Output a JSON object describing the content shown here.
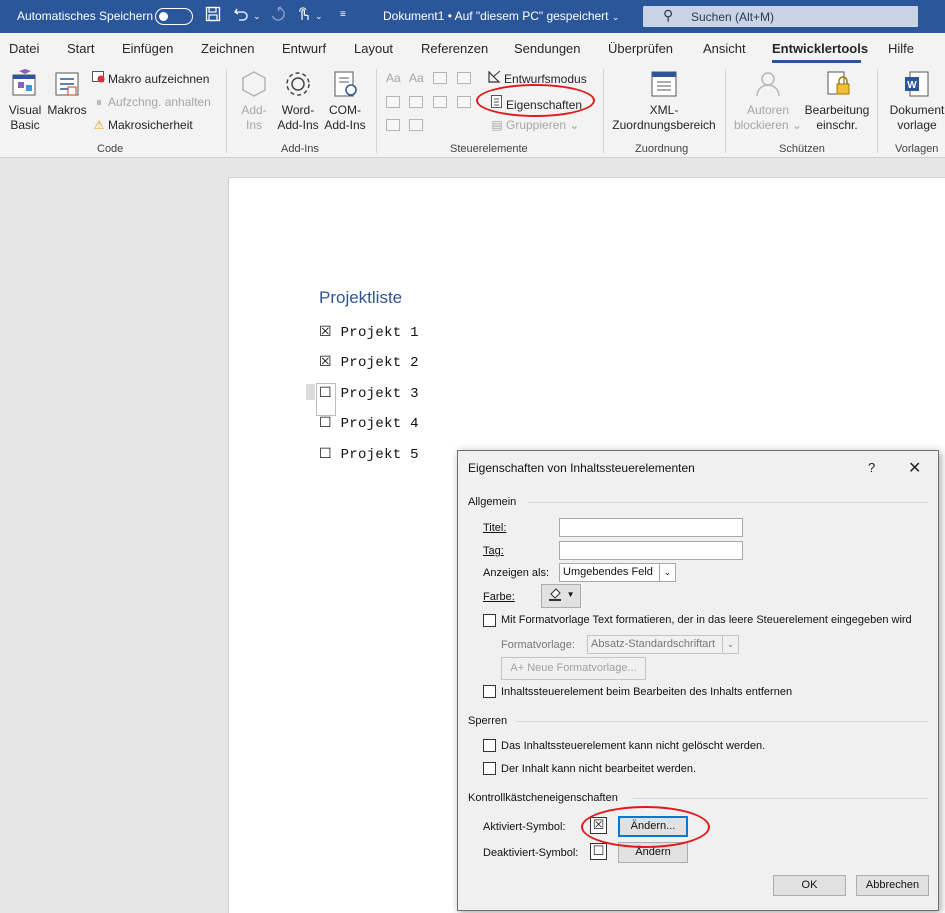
{
  "titlebar": {
    "autosave_label": "Automatisches Speichern",
    "doc_title": "Dokument1 • Auf \"diesem PC\" gespeichert",
    "doc_chevron": "⌄",
    "search_placeholder": "Suchen (Alt+M)"
  },
  "tabs": [
    "Datei",
    "Start",
    "Einfügen",
    "Zeichnen",
    "Entwurf",
    "Layout",
    "Referenzen",
    "Sendungen",
    "Überprüfen",
    "Ansicht",
    "Entwicklertools",
    "Hilfe"
  ],
  "active_tab": "Entwicklertools",
  "ribbon": {
    "code": {
      "visual_basic": [
        "Visual",
        "Basic"
      ],
      "makros": "Makros",
      "makro_aufzeichnen": "Makro aufzeichnen",
      "aufzeichnung_anhalten": "Aufzchng. anhalten",
      "makrosicherheit": "Makrosicherheit",
      "group_label": "Code"
    },
    "addins": {
      "add_ins": [
        "Add-",
        "Ins"
      ],
      "word_addins": [
        "Word-",
        "Add-Ins"
      ],
      "com_addins": [
        "COM-",
        "Add-Ins"
      ],
      "group_label": "Add-Ins"
    },
    "steuerelemente": {
      "entwurfsmodus": "Entwurfsmodus",
      "eigenschaften": "Eigenschaften",
      "gruppieren": "Gruppieren",
      "group_label": "Steuerelemente"
    },
    "zuordnung": {
      "xml": [
        "XML-",
        "Zuordnungsbereich"
      ],
      "group_label": "Zuordnung"
    },
    "schuetzen": {
      "autoren": [
        "Autoren",
        "blockieren"
      ],
      "bearbeitung": [
        "Bearbeitung",
        "einschr."
      ],
      "group_label": "Schützen"
    },
    "vorlagen": {
      "dokument": [
        "Dokument",
        "vorlage"
      ],
      "group_label": "Vorlagen"
    }
  },
  "document": {
    "heading": "Projektliste",
    "items": [
      {
        "symbol": "☒",
        "label": "Projekt 1"
      },
      {
        "symbol": "☒",
        "label": "Projekt 2"
      },
      {
        "symbol": "☐",
        "label": "Projekt 3"
      },
      {
        "symbol": "☐",
        "label": "Projekt 4"
      },
      {
        "symbol": "☐",
        "label": "Projekt 5"
      }
    ]
  },
  "dialog": {
    "title": "Eigenschaften von Inhaltssteuerelementen",
    "help": "?",
    "close": "✕",
    "allgemein": "Allgemein",
    "titel_label": "Titel:",
    "tag_label": "Tag:",
    "titel_value": "",
    "tag_value": "",
    "anzeigen_label": "Anzeigen als:",
    "anzeigen_value": "Umgebendes Feld",
    "farbe_label": "Farbe:",
    "formatvorlage_cb": "Mit Formatvorlage Text formatieren, der in das leere Steuerelement eingegeben wird",
    "formatvorlage_label": "Formatvorlage:",
    "formatvorlage_value": "Absatz-Standardschriftart",
    "neue_formatvorlage": "Neue Formatvorlage...",
    "entfernen_cb": "Inhaltssteuerelement beim Bearbeiten des Inhalts entfernen",
    "sperren": "Sperren",
    "nicht_geloescht": "Das Inhaltssteuerelement kann nicht gelöscht werden.",
    "nicht_bearbeitet": "Der Inhalt kann nicht bearbeitet werden.",
    "kontroll": "Kontrollkästcheneigenschaften",
    "aktiviert_label": "Aktiviert-Symbol:",
    "aktiviert_symbol": "☒",
    "aendern_1": "Ändern...",
    "deaktiviert_label": "Deaktiviert-Symbol:",
    "deaktiviert_symbol": "☐",
    "aendern_2": "Ändern",
    "ok": "OK",
    "abbrechen": "Abbrechen"
  },
  "colors": {
    "titlebar": "#2b579a",
    "heading": "#2f5496",
    "annotation": "#e01a1a"
  }
}
